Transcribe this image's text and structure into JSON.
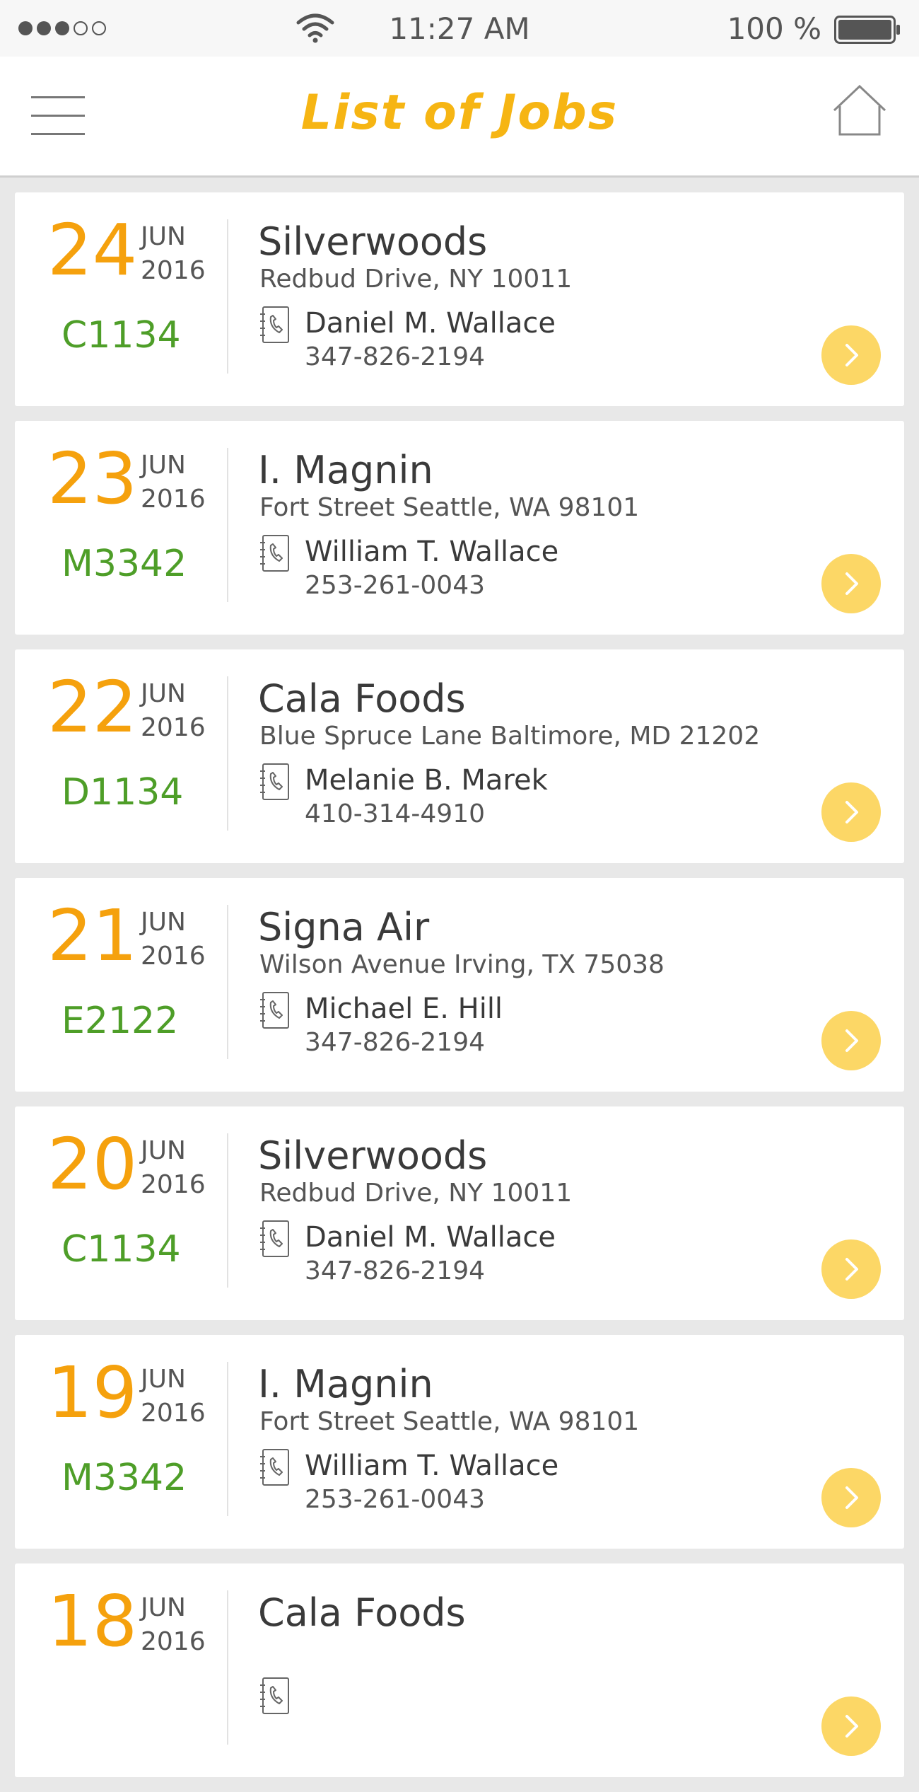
{
  "status_bar": {
    "time": "11:27 AM",
    "battery": "100 %",
    "signal_bars": 3
  },
  "header": {
    "title": "List of Jobs",
    "menu_icon": "hamburger-menu-icon",
    "home_icon": "home-icon"
  },
  "colors": {
    "accent": "#f6b513",
    "day": "#f5a10d",
    "code": "#4e9e28",
    "go_button": "#fcd766"
  },
  "jobs": [
    {
      "day": "24",
      "month": "JUN",
      "year": "2016",
      "code": "C1134",
      "company": "Silverwoods",
      "address": "Redbud Drive, NY 10011",
      "contact": "Daniel M. Wallace",
      "phone": "347-826-2194"
    },
    {
      "day": "23",
      "month": "JUN",
      "year": "2016",
      "code": "M3342",
      "company": "I. Magnin",
      "address": "Fort Street Seattle, WA 98101",
      "contact": "William T. Wallace",
      "phone": "253-261-0043"
    },
    {
      "day": "22",
      "month": "JUN",
      "year": "2016",
      "code": "D1134",
      "company": "Cala Foods",
      "address": "Blue Spruce Lane Baltimore, MD 21202",
      "contact": "Melanie B. Marek",
      "phone": "410-314-4910"
    },
    {
      "day": "21",
      "month": "JUN",
      "year": "2016",
      "code": "E2122",
      "company": "Signa Air",
      "address": "Wilson Avenue Irving, TX 75038",
      "contact": "Michael E. Hill",
      "phone": "347-826-2194"
    },
    {
      "day": "20",
      "month": "JUN",
      "year": "2016",
      "code": "C1134",
      "company": "Silverwoods",
      "address": "Redbud Drive, NY 10011",
      "contact": "Daniel M. Wallace",
      "phone": "347-826-2194"
    },
    {
      "day": "19",
      "month": "JUN",
      "year": "2016",
      "code": "M3342",
      "company": "I. Magnin",
      "address": "Fort Street Seattle, WA 98101",
      "contact": "William T. Wallace",
      "phone": "253-261-0043"
    },
    {
      "day": "18",
      "month": "JUN",
      "year": "2016",
      "code": "",
      "company": "Cala Foods",
      "address": "",
      "contact": "",
      "phone": ""
    }
  ]
}
